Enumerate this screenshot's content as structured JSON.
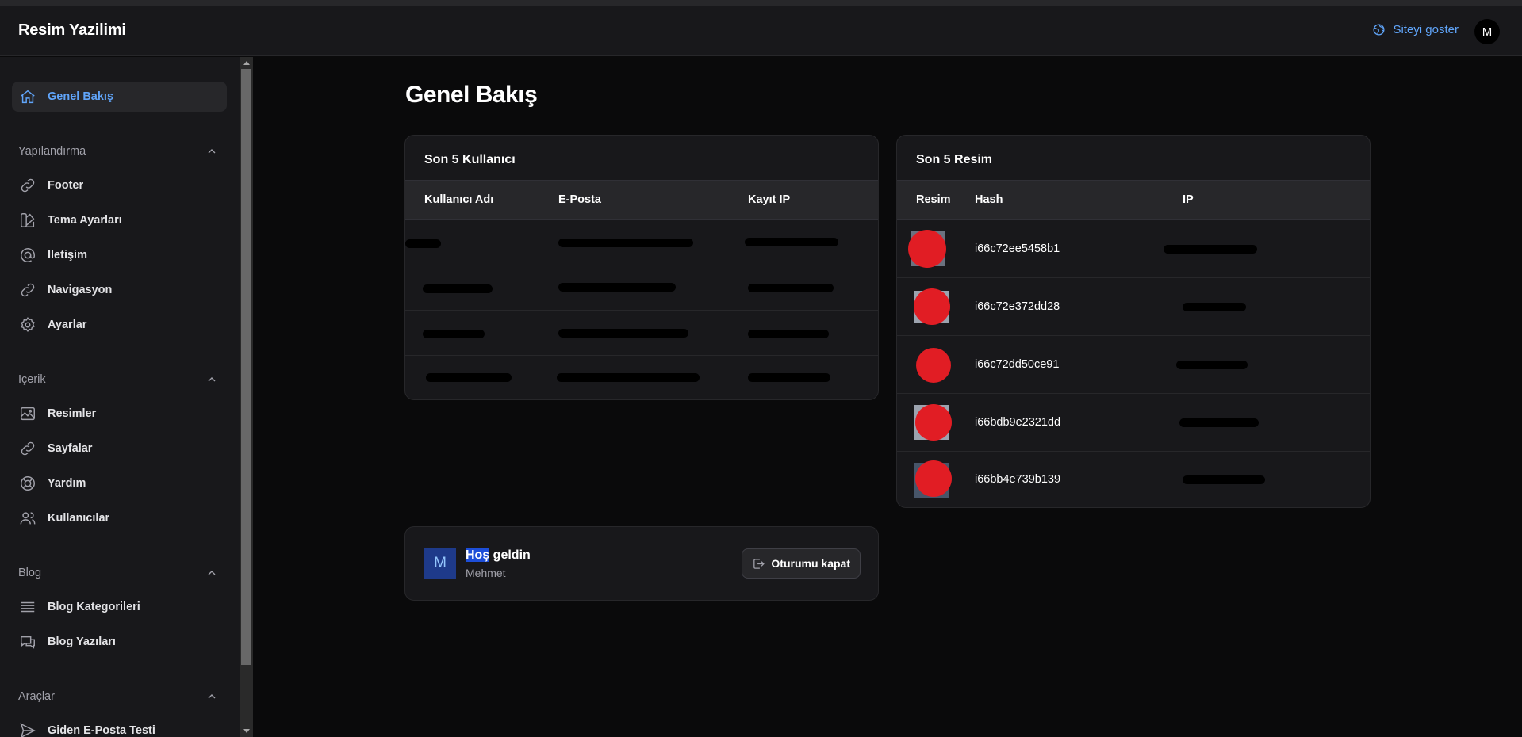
{
  "header": {
    "brand": "Resim Yazilimi",
    "site_link": "Siteyi goster",
    "avatar_initial": "M"
  },
  "sidebar": {
    "active": "Genel Bakış",
    "groups": [
      {
        "label": "Yapılandırma",
        "items": [
          "Footer",
          "Tema Ayarları",
          "Iletişim",
          "Navigasyon",
          "Ayarlar"
        ]
      },
      {
        "label": "Içerik",
        "items": [
          "Resimler",
          "Sayfalar",
          "Yardım",
          "Kullanıcılar"
        ]
      },
      {
        "label": "Blog",
        "items": [
          "Blog Kategorileri",
          "Blog Yazıları"
        ]
      },
      {
        "label": "Araçlar",
        "items": [
          "Giden E-Posta Testi"
        ]
      }
    ]
  },
  "page": {
    "title": "Genel Bakış"
  },
  "users_card": {
    "title": "Son 5 Kullanıcı",
    "columns": [
      "Kullanıcı Adı",
      "E-Posta",
      "Kayıt IP"
    ],
    "row_count": 4
  },
  "images_card": {
    "title": "Son 5 Resim",
    "columns": [
      "Resim",
      "Hash",
      "IP"
    ],
    "rows": [
      {
        "hash": "i66c72ee5458b1"
      },
      {
        "hash": "i66c72e372dd28"
      },
      {
        "hash": "i66c72dd50ce91"
      },
      {
        "hash": "i66bdb9e2321dd"
      },
      {
        "hash": "i66bb4e739b139"
      }
    ]
  },
  "welcome": {
    "avatar_initial": "M",
    "title_selected": "Hoş",
    "title_rest": " geldin",
    "name": "Mehmet",
    "logout_label": "Oturumu kapat"
  }
}
